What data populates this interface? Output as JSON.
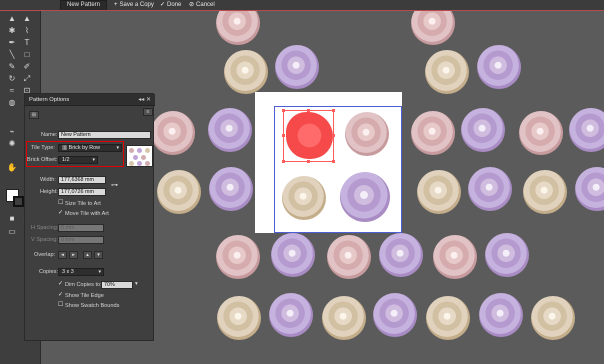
{
  "topbar": {
    "pattern_name": "New Pattern",
    "save_copy": "Save a Copy",
    "done": "Done",
    "cancel": "Cancel",
    "save_icon_sym": "+",
    "done_icon_sym": "✓",
    "cancel_icon_sym": "⊘"
  },
  "panel": {
    "title": "Pattern Options",
    "controls": "◂◂  ✕",
    "name_label": "Name:",
    "name_value": "New Pattern",
    "tile_type_label": "Tile Type:",
    "tile_type_value": "Brick by Row",
    "brick_offset_label": "Brick Offset:",
    "brick_offset_value": "1/2",
    "width_label": "Width:",
    "width_value": "177,6368 mm",
    "height_label": "Height:",
    "height_value": "177,0726 mm",
    "size_tile_label": "Size Tile to Art",
    "move_tile_label": "Move Tile with Art",
    "h_spacing_label": "H Spacing:",
    "h_spacing_value": "0 mm",
    "v_spacing_label": "V Spacing:",
    "v_spacing_value": "0 mm",
    "overlap_label": "Overlap:",
    "copies_label": "Copies:",
    "copies_value": "3 x 3",
    "dim_copies_label": "Dim Copies to:",
    "dim_copies_value": "70%",
    "show_tile_edge_label": "Show Tile Edge",
    "show_swatch_bounds_label": "Show Swatch Bounds"
  },
  "colors": {
    "selection_red": "#ff5c5c",
    "tile_edge_blue": "#4d5fd6",
    "highlight_red": "#e10000"
  },
  "icons": {
    "tools": [
      "selection-tool",
      "direct-selection-tool",
      "magic-wand-tool",
      "lasso-tool",
      "pen-tool",
      "type-tool",
      "line-tool",
      "rectangle-tool",
      "paintbrush-tool",
      "pencil-tool",
      "rotate-tool",
      "scale-tool",
      "warp-tool",
      "free-transform-tool",
      "shape-builder-tool",
      "perspective-grid-tool",
      "mesh-tool",
      "gradient-tool",
      "eyedropper-tool",
      "blend-tool",
      "symbol-sprayer-tool",
      "column-graph-tool",
      "artboard-tool",
      "slice-tool",
      "hand-tool",
      "zoom-tool"
    ]
  }
}
